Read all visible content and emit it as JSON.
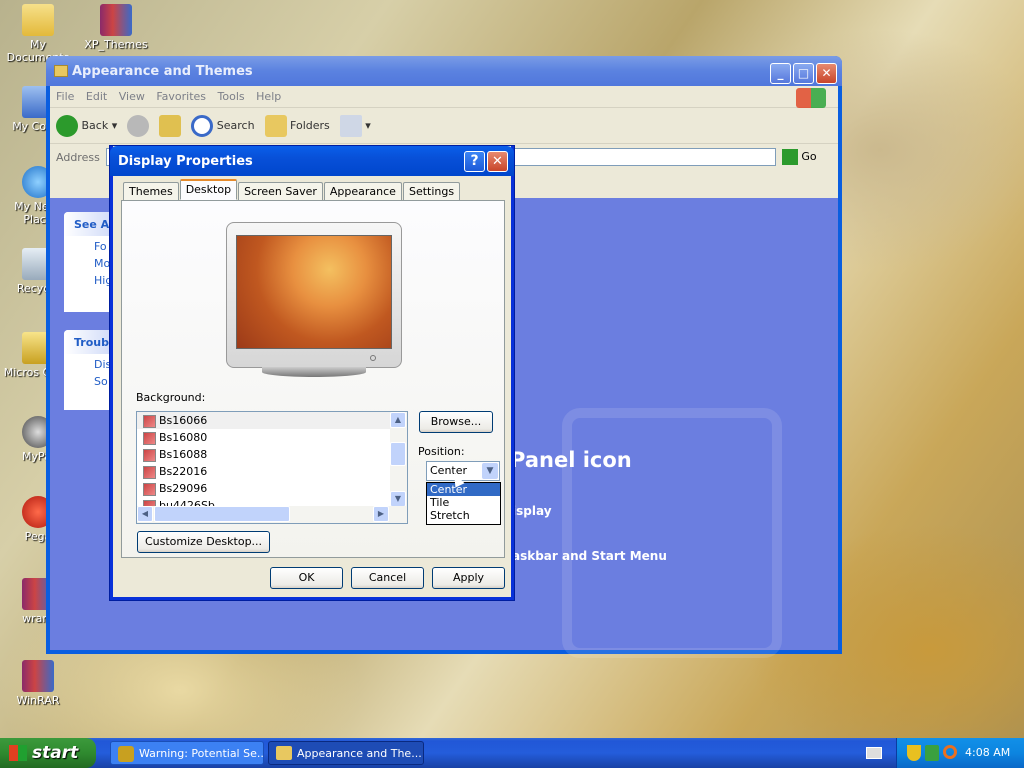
{
  "desktop_icons": [
    {
      "label": "My Documents"
    },
    {
      "label": "XP_Themes"
    },
    {
      "label": "My Comp"
    },
    {
      "label": "My Netw Place"
    },
    {
      "label": "Recycle"
    },
    {
      "label": "Micros Outlo"
    },
    {
      "label": "MyPal"
    },
    {
      "label": "Pega"
    },
    {
      "label": "wrarS"
    },
    {
      "label": "WinRAR"
    }
  ],
  "explorer": {
    "title": "Appearance and Themes",
    "menu": [
      "File",
      "Edit",
      "View",
      "Favorites",
      "Tools",
      "Help"
    ],
    "toolbar": {
      "back": "Back",
      "search": "Search",
      "folders": "Folders"
    },
    "address_label": "Address",
    "go_label": "Go",
    "see_also": "See Al",
    "see_also_items": [
      "Fo",
      "Mo",
      "Hig"
    ],
    "troubleshooters": "Troubl",
    "troubleshooter_items": [
      "Dis",
      "So"
    ],
    "main_heading": "Panel icon",
    "links": [
      "isplay",
      "askbar and Start Menu"
    ]
  },
  "dialog": {
    "title": "Display Properties",
    "help_icon": "?",
    "tabs": [
      "Themes",
      "Desktop",
      "Screen Saver",
      "Appearance",
      "Settings"
    ],
    "background_label": "Background:",
    "backgrounds": [
      "Bs16066",
      "Bs16080",
      "Bs16088",
      "Bs22016",
      "Bs29096",
      "bu4426Sb"
    ],
    "browse": "Browse...",
    "position_label": "Position:",
    "position_value": "Center",
    "position_options": [
      "Center",
      "Tile",
      "Stretch"
    ],
    "customize": "Customize Desktop...",
    "ok": "OK",
    "cancel": "Cancel",
    "apply": "Apply"
  },
  "taskbar": {
    "start": "start",
    "tasks": [
      "Warning: Potential Se...",
      "Appearance and The..."
    ],
    "clock": "4:08 AM"
  }
}
